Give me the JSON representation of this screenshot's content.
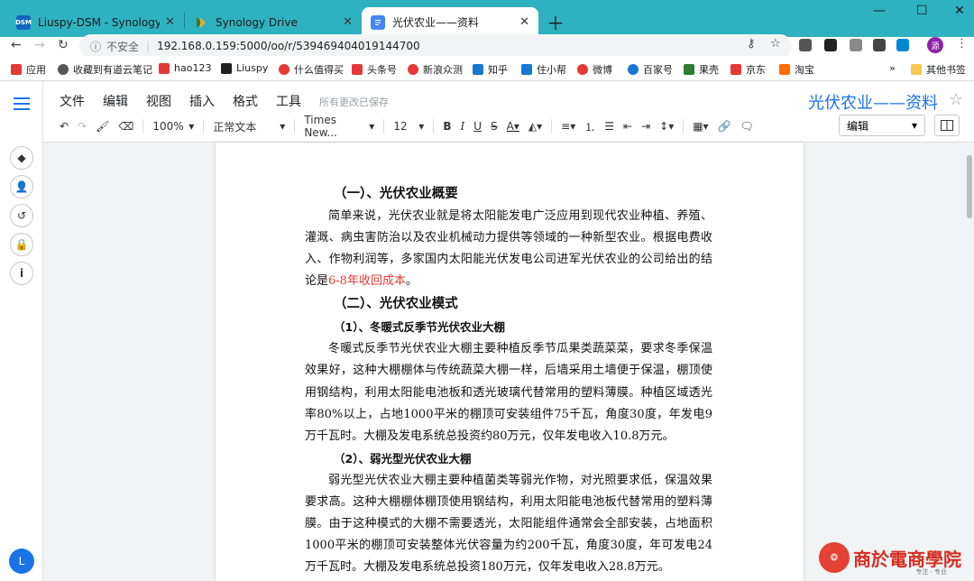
{
  "browser": {
    "tabs": [
      {
        "title": "Liuspy-DSM - Synology DiskSt",
        "favicon": "DSM",
        "favicon_color": "#1565c0",
        "active": false
      },
      {
        "title": "Synology Drive",
        "favicon": "",
        "favicon_color": "#2e7d32",
        "active": false
      },
      {
        "title": "光伏农业——资料",
        "favicon": "",
        "favicon_color": "#4285f4",
        "active": true
      }
    ],
    "insecure_label": "不安全",
    "url": "192.168.0.159:5000/oo/r/539469404019144700",
    "profile_initial": "源",
    "bookmarks": [
      {
        "label": "应用",
        "color": "#e53935"
      },
      {
        "label": "收藏到有道云笔记",
        "color": "#555555"
      },
      {
        "label": "hao123",
        "color": "#e53935"
      },
      {
        "label": "Liuspy",
        "color": "#212121"
      },
      {
        "label": "什么值得买",
        "color": "#e53935"
      },
      {
        "label": "头条号",
        "color": "#e53935"
      },
      {
        "label": "新浪众测",
        "color": "#e53935"
      },
      {
        "label": "知乎",
        "color": "#1976d2"
      },
      {
        "label": "住小帮",
        "color": "#1976d2"
      },
      {
        "label": "微博",
        "color": "#e53935"
      },
      {
        "label": "百家号",
        "color": "#1976d2"
      },
      {
        "label": "果壳",
        "color": "#2e7d32"
      },
      {
        "label": "京东",
        "color": "#e53935"
      },
      {
        "label": "淘宝",
        "color": "#ff6d00"
      }
    ],
    "more_bookmarks": "»",
    "other_bookmarks": "其他书签"
  },
  "sidebar": {
    "user_initial": "L"
  },
  "doc": {
    "menu": [
      "文件",
      "编辑",
      "视图",
      "插入",
      "格式",
      "工具"
    ],
    "saved_status": "所有更改已保存",
    "title": "光伏农业——资料",
    "toolbar": {
      "zoom": "100%",
      "style": "正常文本",
      "font": "Times New...",
      "size": "12"
    },
    "mode": "编辑",
    "h1_overview": "（一）、光伏农业概要",
    "p1_main": "简单来说，光伏农业就是将太阳能发电广泛应用到现代农业种植、养殖、灌溉、病虫害防治以及农业机械动力提供等领域的一种新型农业。根据电费收入、作物利润等，多家国内太阳能光伏发电公司进军光伏农业的公司给出的结论是",
    "p1_red": "6-8年收回成本",
    "p1_end": "。",
    "h1_modes": "（二）、光伏农业模式",
    "h2_greenhouse": "（1）、冬暖式反季节光伏农业大棚",
    "p2": "冬暖式反季节光伏农业大棚主要种植反季节瓜果类蔬菜菜，要求冬季保温效果好，这种大棚棚体与传统蔬菜大棚一样，后墙采用土墙便于保温，棚顶使用钢结构，利用太阳能电池板和透光玻璃代替常用的塑料薄膜。种植区域透光率80%以上，占地1000平米的棚顶可安装组件75千瓦，角度30度，年发电9万千瓦时。大棚及发电系统总投资约80万元，仅年发电收入10.8万元。",
    "h2_weaklight": "（2）、弱光型光伏农业大棚",
    "p3": "弱光型光伏农业大棚主要种植菌类等弱光作物，对光照要求低，保温效果要求高。这种大棚棚体棚顶使用钢结构，利用太阳能电池板代替常用的塑料薄膜。由于这种模式的大棚不需要透光，太阳能组件通常会全部安装，占地面积1000平米的棚顶可安装整体光伏容量为约200千瓦，角度30度，年可发电24万千瓦时。大棚及发电系统总投资180万元，仅年发电收入28.8万元。"
  },
  "watermark": {
    "text": "商於電商學院",
    "sub": "专注 · 专业"
  }
}
